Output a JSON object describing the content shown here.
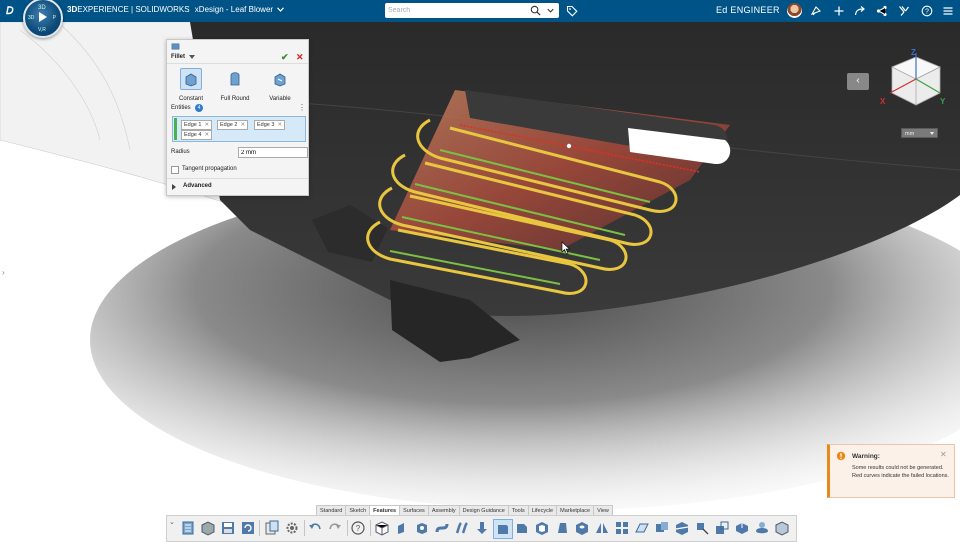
{
  "topbar": {
    "brand_prefix": "3D",
    "brand_main": "EXPERIENCE | SOLIDWORKS",
    "app_doc": "xDesign - Leaf Blower",
    "search_placeholder": "Search",
    "user_name": "Ed ENGINEER",
    "compass": {
      "top": "3D",
      "left": "3D",
      "right": "P",
      "bottom": "V,R"
    },
    "icons": [
      "tag-icon",
      "notification-icon",
      "share-icon",
      "add-icon",
      "forward-icon",
      "network-share-icon",
      "tools-icon",
      "help-icon",
      "menu-icon"
    ]
  },
  "fillet_panel": {
    "title": "Fillet",
    "types": [
      {
        "label": "Constant",
        "selected": true
      },
      {
        "label": "Full Round",
        "selected": false
      },
      {
        "label": "Variable",
        "selected": false
      }
    ],
    "entities_label": "Entities",
    "entities_count": "4",
    "edges": [
      "Edge 1",
      "Edge 2",
      "Edge 3",
      "Edge 4"
    ],
    "radius_label": "Radius",
    "radius_value": "2 mm",
    "tangent_label": "Tangent propagation",
    "tangent_checked": false,
    "advanced_label": "Advanced"
  },
  "viewcube": {
    "axes": [
      "Z",
      "X",
      "Y"
    ],
    "units": "mm"
  },
  "warning": {
    "title": "Warning:",
    "message": "Some results could not be generated. Red curves indicate the failed locations."
  },
  "toolbar": {
    "tabs": [
      "Standard",
      "Sketch",
      "Features",
      "Surfaces",
      "Assembly",
      "Design Guidance",
      "Tools",
      "Lifecycle",
      "Marketplace",
      "View"
    ],
    "active_tab": "Features"
  },
  "colors": {
    "topbar": "#005386",
    "highlight": "#e8c640",
    "edge_green": "#7bc043",
    "error_red": "#e03020",
    "warning_accent": "#e88a1a",
    "selection_blue": "#d6e9f8"
  }
}
